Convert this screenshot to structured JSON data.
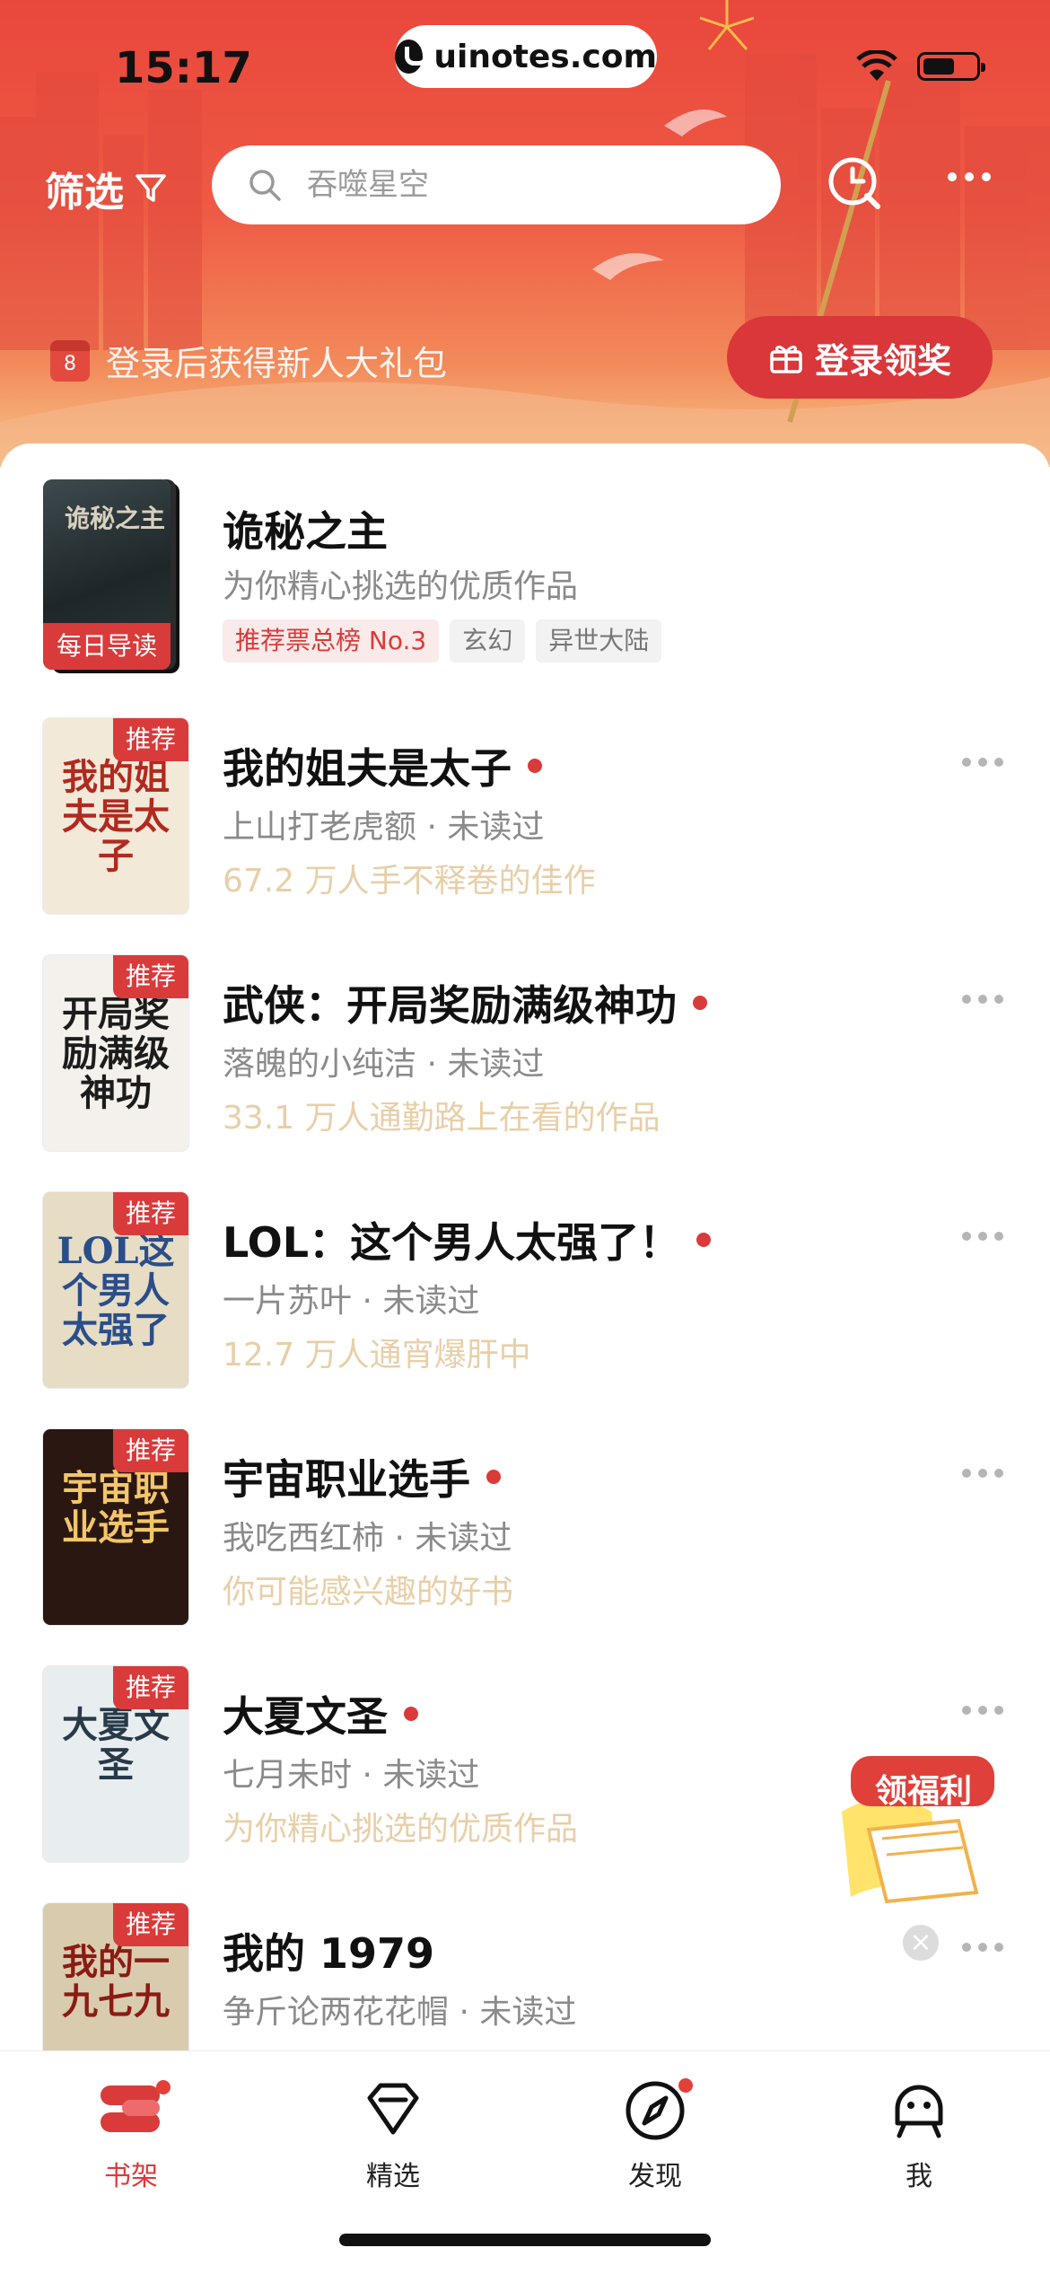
{
  "status_bar": {
    "time": "15:17",
    "url": "uinotes.com"
  },
  "header": {
    "filter_label": "筛选",
    "search_placeholder": "吞噬星空",
    "login_tip": "登录后获得新人大礼包",
    "calendar_day": "8",
    "login_button": "登录领奖"
  },
  "featured": {
    "title": "诡秘之主",
    "subtitle": "为你精心挑选的优质作品",
    "badge": "每日导读",
    "cover_text": "诡秘之主",
    "tags": [
      "推荐票总榜 No.3",
      "玄幻",
      "异世大陆"
    ]
  },
  "rec_badge": "推荐",
  "books": [
    {
      "title": "我的姐夫是太子",
      "author_status": "上山打老虎额 · 未读过",
      "note": "67.2 万人手不释卷的佳作",
      "cover_text": "我的姐夫是太子",
      "cover_bg": "#f3e9d8",
      "cover_fg": "#b02a1f"
    },
    {
      "title": "武侠：开局奖励满级神功",
      "author_status": "落魄的小纯洁 · 未读过",
      "note": "33.1 万人通勤路上在看的作品",
      "cover_text": "开局奖励满级神功",
      "cover_bg": "#f4f1ec",
      "cover_fg": "#1c1c1c"
    },
    {
      "title": "LOL：这个男人太强了！",
      "author_status": "一片苏叶 · 未读过",
      "note": "12.7 万人通宵爆肝中",
      "cover_text": "LOL这个男人太强了",
      "cover_bg": "#e7dcc4",
      "cover_fg": "#2a4e8a"
    },
    {
      "title": "宇宙职业选手",
      "author_status": "我吃西红柿 · 未读过",
      "note": "你可能感兴趣的好书",
      "cover_text": "宇宙职业选手",
      "cover_bg": "#2b1712",
      "cover_fg": "#f2c66a"
    },
    {
      "title": "大夏文圣",
      "author_status": "七月未时 · 未读过",
      "note": "为你精心挑选的优质作品",
      "cover_text": "大夏文圣",
      "cover_bg": "#e8eef0",
      "cover_fg": "#283a48"
    },
    {
      "title": "我的 1979",
      "author_status": "争斤论两花花帽 · 未读过",
      "note": "",
      "cover_text": "我的一九七九",
      "cover_bg": "#d9ccae",
      "cover_fg": "#8a1c14"
    }
  ],
  "float_ad": {
    "label": "领福利"
  },
  "tabs": [
    {
      "label": "书架",
      "icon": "bookshelf-icon",
      "active": true
    },
    {
      "label": "精选",
      "icon": "diamond-icon"
    },
    {
      "label": "发现",
      "icon": "compass-icon"
    },
    {
      "label": "我",
      "icon": "profile-icon"
    }
  ],
  "colors": {
    "accent": "#d93b3b",
    "header_top": "#e9473c",
    "note": "#e8cfa8"
  }
}
